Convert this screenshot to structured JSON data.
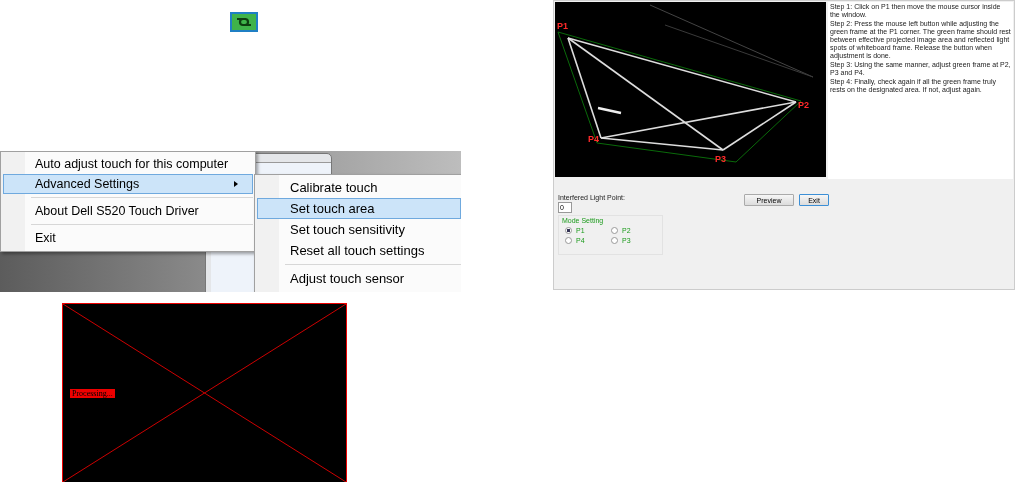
{
  "context_menu": {
    "items": [
      {
        "kind": "item",
        "label": "Auto adjust touch for this computer",
        "selected": false,
        "has_submenu": false
      },
      {
        "kind": "item",
        "label": "Advanced Settings",
        "selected": true,
        "has_submenu": true
      },
      {
        "kind": "separator"
      },
      {
        "kind": "item",
        "label": "About Dell S520 Touch Driver",
        "selected": false,
        "has_submenu": false
      },
      {
        "kind": "separator"
      },
      {
        "kind": "item",
        "label": "Exit",
        "selected": false,
        "has_submenu": false
      }
    ]
  },
  "submenu": {
    "items": [
      {
        "kind": "item",
        "label": "Calibrate touch",
        "selected": false
      },
      {
        "kind": "item",
        "label": "Set touch area",
        "selected": true
      },
      {
        "kind": "item",
        "label": "Set touch sensitivity",
        "selected": false
      },
      {
        "kind": "item",
        "label": "Reset all touch settings",
        "selected": false
      },
      {
        "kind": "separator"
      },
      {
        "kind": "item",
        "label": "Adjust touch sensor",
        "selected": false
      }
    ]
  },
  "processing_screen": {
    "label": "Processing..."
  },
  "calibration_window": {
    "point_labels": [
      "P1",
      "P2",
      "P3",
      "P4"
    ],
    "instructions": [
      "Step 1: Click on P1 then move the mouse cursor inside the window.",
      "Step 2: Press the mouse left button while adjusting the green frame at the P1 corner. The green frame should rest between effective projected image area and reflected light spots of whiteboard frame. Release the button when adjustment is done.",
      "Step 3: Using the same manner, adjust green frame at P2, P3 and P4.",
      "Step 4: Finally, check again if all the green frame truly rests on the designated area. If not, adjust again."
    ],
    "interfered_light_point": {
      "label": "Interfered Light Point:",
      "value": "0"
    },
    "mode_setting": {
      "title": "Mode Setting",
      "options": [
        {
          "label": "P1",
          "selected": true
        },
        {
          "label": "P2",
          "selected": false
        },
        {
          "label": "P4",
          "selected": false
        },
        {
          "label": "P3",
          "selected": false
        }
      ]
    },
    "buttons": [
      {
        "label": "Preview",
        "default": false
      },
      {
        "label": "Exit",
        "default": true
      }
    ]
  }
}
